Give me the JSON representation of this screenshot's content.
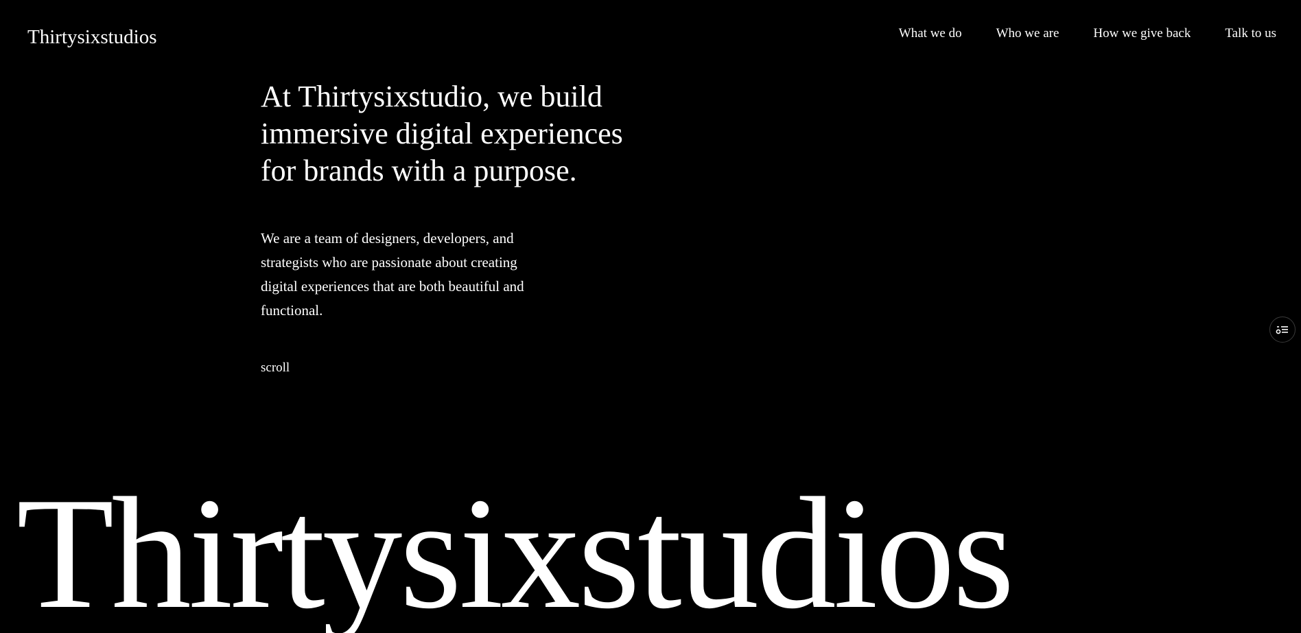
{
  "header": {
    "logo": "Thirtysixstudios",
    "nav": [
      {
        "label": "What we do"
      },
      {
        "label": "Who we are"
      },
      {
        "label": "How we give back"
      },
      {
        "label": "Talk to us"
      }
    ]
  },
  "hero": {
    "headline": "At Thirtysixstudio, we build immersive digital experiences for brands with a purpose.",
    "intro": "We are a team of designers, developers, and strategists who are passionate about creating digital experiences that are both beautiful and functional.",
    "scroll_label": "scroll"
  },
  "footer": {
    "big_wordmark": "Thirtysixstudios"
  },
  "side_widget": {
    "icon": "settings-list-icon"
  },
  "colors": {
    "background": "#000000",
    "text": "#ffffff"
  }
}
